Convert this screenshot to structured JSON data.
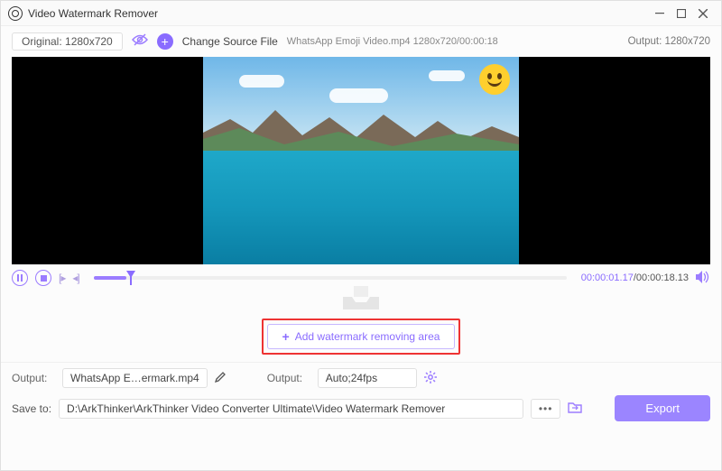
{
  "window": {
    "title": "Video Watermark Remover"
  },
  "top": {
    "original_label": "Original: 1280x720",
    "change_source": "Change Source File",
    "source_info": "WhatsApp Emoji Video.mp4    1280x720/00:00:18",
    "output_res": "Output: 1280x720"
  },
  "playback": {
    "current": "00:00:01.17",
    "total": "/00:00:18.13",
    "progress_pct": 7
  },
  "add_area": {
    "label": "Add watermark removing area"
  },
  "output": {
    "label1": "Output:",
    "filename": "WhatsApp E…ermark.mp4",
    "label2": "Output:",
    "format": "Auto;24fps"
  },
  "save": {
    "label": "Save to:",
    "path": "D:\\ArkThinker\\ArkThinker Video Converter Ultimate\\Video Watermark Remover"
  },
  "export": {
    "label": "Export"
  }
}
